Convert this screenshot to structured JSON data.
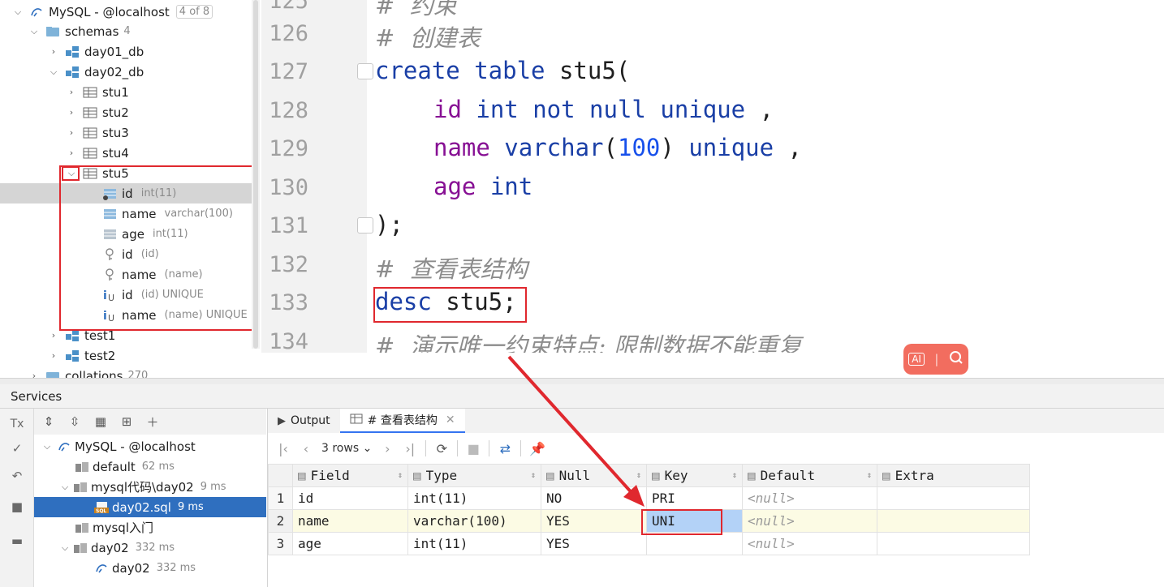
{
  "db_tree": {
    "connection": {
      "label": "MySQL - @localhost",
      "badge": "4 of 8"
    },
    "schemas": {
      "label": "schemas",
      "count": "4"
    },
    "items": [
      {
        "label": "day01_db"
      },
      {
        "label": "day02_db"
      },
      {
        "label": "stu1"
      },
      {
        "label": "stu2"
      },
      {
        "label": "stu3"
      },
      {
        "label": "stu4"
      },
      {
        "label": "stu5"
      }
    ],
    "columns": [
      {
        "label": "id",
        "sub": "int(11)"
      },
      {
        "label": "name",
        "sub": "varchar(100)"
      },
      {
        "label": "age",
        "sub": "int(11)"
      }
    ],
    "keys": [
      {
        "label": "id",
        "sub": "(id)"
      },
      {
        "label": "name",
        "sub": "(name)"
      }
    ],
    "indexes": [
      {
        "label": "id",
        "sub": "(id) UNIQUE"
      },
      {
        "label": "name",
        "sub": "(name) UNIQUE"
      }
    ],
    "after": [
      {
        "label": "test1"
      },
      {
        "label": "test2"
      }
    ],
    "collations": {
      "label": "collations",
      "count": "270"
    }
  },
  "editor": {
    "lines": [
      {
        "n": "126",
        "comment": "#  创建表"
      },
      {
        "n": "127",
        "kw1": "create table",
        "rest": " stu5("
      },
      {
        "n": "128",
        "col": "id",
        "kw": " int not null unique",
        "tail": " ,"
      },
      {
        "n": "129",
        "col": "name",
        "kw": " varchar",
        "paren_open": "(",
        "num": "100",
        "paren_close": ")",
        "kw2": " unique",
        "tail": " ,"
      },
      {
        "n": "130",
        "col": "age",
        "kw": " int"
      },
      {
        "n": "131",
        "text": ");"
      },
      {
        "n": "132",
        "comment": "#  查看表结构"
      },
      {
        "n": "133",
        "kw1": "desc",
        "rest": " stu5;"
      },
      {
        "n": "134",
        "comment": "#  演示唯一约束特点: 限制数据不能重复"
      }
    ],
    "top_partial": {
      "n": "125",
      "comment": "#  约束"
    }
  },
  "services": {
    "title": "Services",
    "tree": [
      {
        "label": "MySQL - @localhost",
        "sub": ""
      },
      {
        "label": "default",
        "sub": "62 ms"
      },
      {
        "label": "mysql代码\\day02",
        "sub": "9 ms"
      },
      {
        "label": "day02.sql",
        "sub": "9 ms"
      },
      {
        "label": "mysql入门",
        "sub": ""
      },
      {
        "label": "day02",
        "sub": "332 ms"
      },
      {
        "label": "day02",
        "sub": "332 ms"
      }
    ]
  },
  "result": {
    "tabs": [
      {
        "label": "Output"
      },
      {
        "label": "# 查看表结构"
      }
    ],
    "rows_selector": "3 rows",
    "columns": [
      "Field",
      "Type",
      "Null",
      "Key",
      "Default",
      "Extra"
    ],
    "rows": [
      {
        "n": "1",
        "Field": "id",
        "Type": "int(11)",
        "Null": "NO",
        "Key": "PRI",
        "Default": "<null>",
        "Extra": ""
      },
      {
        "n": "2",
        "Field": "name",
        "Type": "varchar(100)",
        "Null": "YES",
        "Key": "UNI",
        "Default": "<null>",
        "Extra": ""
      },
      {
        "n": "3",
        "Field": "age",
        "Type": "int(11)",
        "Null": "YES",
        "Key": "",
        "Default": "<null>",
        "Extra": ""
      }
    ]
  },
  "ai_widget": {
    "left_glyph": "AI",
    "right_glyph": "search-icon"
  },
  "colors": {
    "accent": "#3574f0",
    "annotation_red": "#e0282e",
    "selection": "#2f6fbf"
  }
}
